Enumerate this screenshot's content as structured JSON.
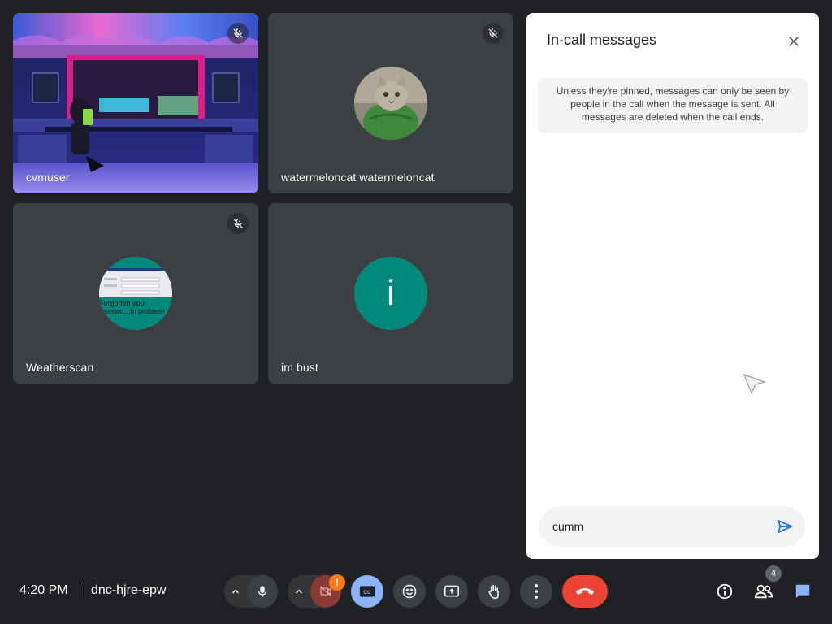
{
  "tiles": [
    {
      "name": "cvmuser",
      "muted": true
    },
    {
      "name": "watermeloncat watermeloncat",
      "muted": true
    },
    {
      "name": "Weatherscan",
      "muted": true,
      "avatar_text": "Forgotten you passwo...In problem"
    },
    {
      "name": "im bust",
      "muted": false,
      "avatar_letter": "i"
    }
  ],
  "chat": {
    "title": "In-call messages",
    "notice": "Unless they're pinned, messages can only be seen by people in the call when the message is sent. All messages are deleted when the call ends.",
    "input_value": "cumm"
  },
  "footer": {
    "time": "4:20 PM",
    "meeting_code": "dnc-hjre-epw",
    "people_count": "4",
    "camera_warning": "!"
  },
  "colors": {
    "background": "#202124",
    "tile": "#3c4043",
    "teal_avatar": "#00897b",
    "accent_blue": "#1a73e8",
    "end_call_red": "#ea4335",
    "captions_active": "#8ab4f8",
    "warning_orange": "#fa7b17"
  },
  "icons": {
    "muted": "mic-off-icon",
    "close": "close-icon",
    "send": "send-icon",
    "mic": "mic-icon",
    "camera_off": "camera-off-icon",
    "captions": "captions-icon",
    "emoji": "emoji-icon",
    "present": "present-screen-icon",
    "raise_hand": "raise-hand-icon",
    "more": "more-options-icon",
    "end_call": "end-call-icon",
    "info": "info-icon",
    "people": "people-icon",
    "chat": "chat-icon"
  }
}
